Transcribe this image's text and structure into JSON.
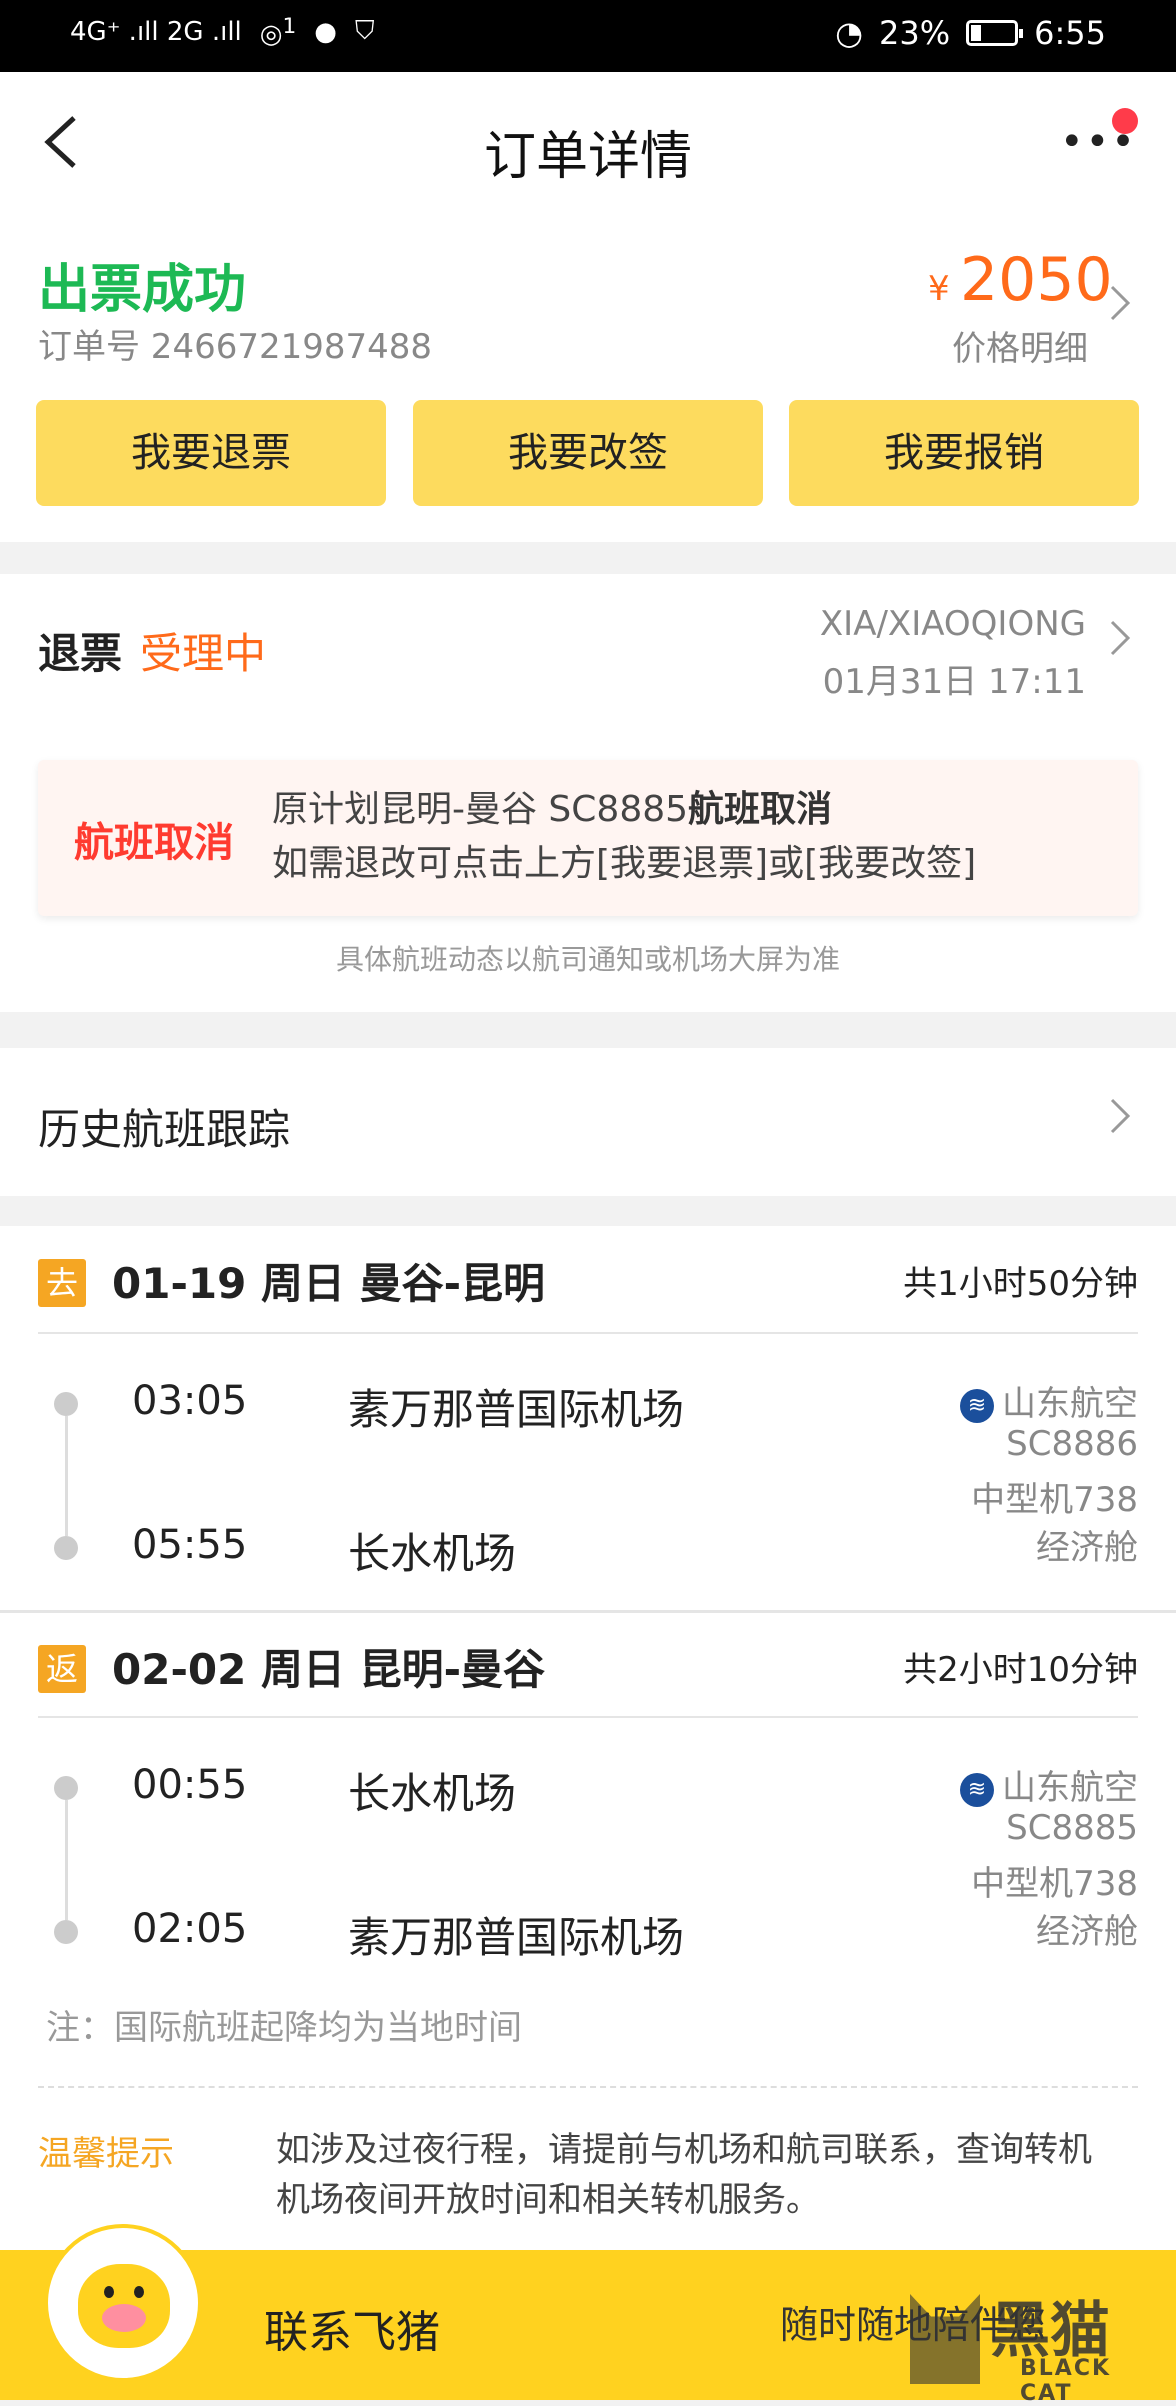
{
  "status_bar": {
    "network": "4G⁺ .ıll 2G .ıll",
    "wifi_badge": "1",
    "battery": "23%",
    "time": "6:55"
  },
  "nav": {
    "title": "订单详情",
    "more": "•••"
  },
  "order": {
    "status": "出票成功",
    "order_number": "订单号 2466721987488",
    "currency": "¥",
    "price": "2050",
    "price_detail": "价格明细",
    "actions": [
      "我要退票",
      "我要改签",
      "我要报销"
    ]
  },
  "refund": {
    "label": "退票",
    "state": "受理中",
    "passenger": "XIA/XIAOQIONG",
    "time": "01月31日 17:11",
    "notice": {
      "tag": "航班取消",
      "line1_prefix": "原计划昆明-曼谷 SC8885",
      "line1_bold": "航班取消",
      "line2": "如需退改可点击上方[我要退票]或[我要改签]"
    },
    "footnote": "具体航班动态以航司通知或机场大屏为准"
  },
  "history": {
    "label": "历史航班跟踪"
  },
  "segments": [
    {
      "tag": "去",
      "title": "01-19 周日 曼谷-昆明",
      "duration": "共1小时50分钟",
      "dep_time": "03:05",
      "dep_airport": "素万那普国际机场",
      "arr_time": "05:55",
      "arr_airport": "长水机场",
      "airline": "山东航空",
      "flight_no": "SC8886",
      "aircraft": "中型机738",
      "cabin": "经济舱"
    },
    {
      "tag": "返",
      "title": "02-02 周日 昆明-曼谷",
      "duration": "共2小时10分钟",
      "dep_time": "00:55",
      "dep_airport": "长水机场",
      "arr_time": "02:05",
      "arr_airport": "素万那普国际机场",
      "airline": "山东航空",
      "flight_no": "SC8885",
      "aircraft": "中型机738",
      "cabin": "经济舱"
    }
  ],
  "intl_note": "注：国际航班起降均为当地时间",
  "tips": {
    "label": "温馨提示",
    "line1": "如涉及过夜行程，请提前与机场和航司联系，查询转机",
    "line2": "机场夜间开放时间和相关转机服务。"
  },
  "bottom": {
    "contact": "联系飞猪",
    "sub": "随时随地陪伴您",
    "watermark_big": "黑猫",
    "watermark_small": "BLACK CAT"
  },
  "colors": {
    "success": "#1db954",
    "accent": "#ff6a1a",
    "button_yellow": "#fddb5e",
    "bar_yellow": "#ffd21f",
    "alert_red": "#ff3b30"
  }
}
